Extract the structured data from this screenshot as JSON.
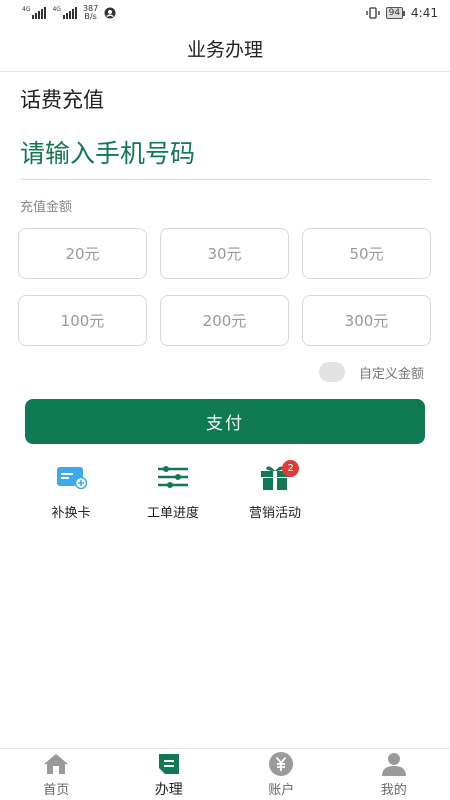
{
  "status_bar": {
    "signal1_tag": "4G",
    "signal2_tag": "4G",
    "speed_value": "387",
    "speed_unit": "B/s",
    "battery": "94",
    "time": "4:41"
  },
  "header": {
    "title": "业务办理"
  },
  "recharge": {
    "section_title": "话费充值",
    "phone_placeholder": "请输入手机号码",
    "amount_label": "充值金额",
    "amounts": [
      "20元",
      "30元",
      "50元",
      "100元",
      "200元",
      "300元"
    ],
    "custom_amount_label": "自定义金额",
    "pay_label": "支付"
  },
  "quick_actions": [
    {
      "label": "补换卡",
      "icon": "sim-card-replace-icon"
    },
    {
      "label": "工单进度",
      "icon": "progress-sliders-icon"
    },
    {
      "label": "营销活动",
      "icon": "gift-icon",
      "badge": "2"
    }
  ],
  "tabbar": {
    "items": [
      {
        "label": "首页",
        "icon": "home-icon",
        "active": false
      },
      {
        "label": "办理",
        "icon": "handle-icon",
        "active": true
      },
      {
        "label": "账户",
        "icon": "yuan-coin-icon",
        "active": false
      },
      {
        "label": "我的",
        "icon": "user-icon",
        "active": false
      }
    ]
  },
  "colors": {
    "primary": "#0f7a52",
    "badge": "#e53935",
    "quick_blue": "#3fa9e8"
  }
}
